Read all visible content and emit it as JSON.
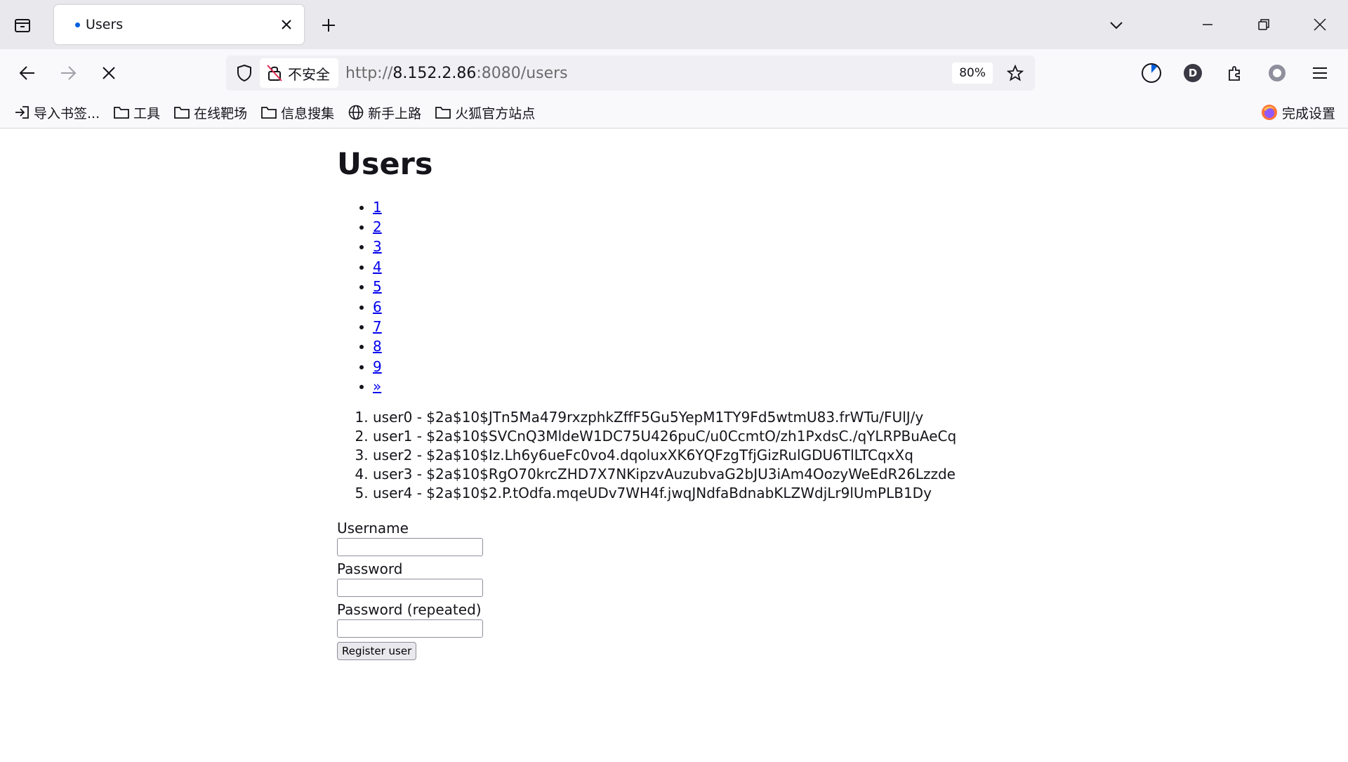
{
  "browser": {
    "tab": {
      "title": "Users"
    },
    "url": {
      "scheme": "http://",
      "host": "8.152.2.86",
      "rest": ":8080/users"
    },
    "security_label": "不安全",
    "zoom": "80%",
    "profile_initial": "D",
    "bookmarks": [
      {
        "label": "导入书签...",
        "icon": "import-icon"
      },
      {
        "label": "工具",
        "icon": "folder-icon"
      },
      {
        "label": "在线靶场",
        "icon": "folder-icon"
      },
      {
        "label": "信息搜集",
        "icon": "folder-icon"
      },
      {
        "label": "新手上路",
        "icon": "globe-icon"
      },
      {
        "label": "火狐官方站点",
        "icon": "folder-icon"
      }
    ],
    "bookmark_right": {
      "label": "完成设置",
      "icon": "firefox-icon"
    }
  },
  "page": {
    "title": "Users",
    "pager": [
      "1",
      "2",
      "3",
      "4",
      "5",
      "6",
      "7",
      "8",
      "9",
      "»"
    ],
    "users": [
      "user0 - $2a$10$JTn5Ma479rxzphkZffF5Gu5YepM1TY9Fd5wtmU83.frWTu/FUlJ/y",
      "user1 - $2a$10$SVCnQ3MldeW1DC75U426puC/u0CcmtO/zh1PxdsC./qYLRPBuAeCq",
      "user2 - $2a$10$Iz.Lh6y6ueFc0vo4.dqoluxXK6YQFzgTfjGizRulGDU6TlLTCqxXq",
      "user3 - $2a$10$RgO70krcZHD7X7NKipzvAuzubvaG2bJU3iAm4OozyWeEdR26Lzzde",
      "user4 - $2a$10$2.P.tOdfa.mqeUDv7WH4f.jwqJNdfaBdnabKLZWdjLr9lUmPLB1Dy"
    ],
    "form": {
      "username_label": "Username",
      "password_label": "Password",
      "password_repeat_label": "Password (repeated)",
      "username_value": "",
      "password_value": "",
      "password_repeat_value": "",
      "submit_label": "Register user"
    }
  }
}
